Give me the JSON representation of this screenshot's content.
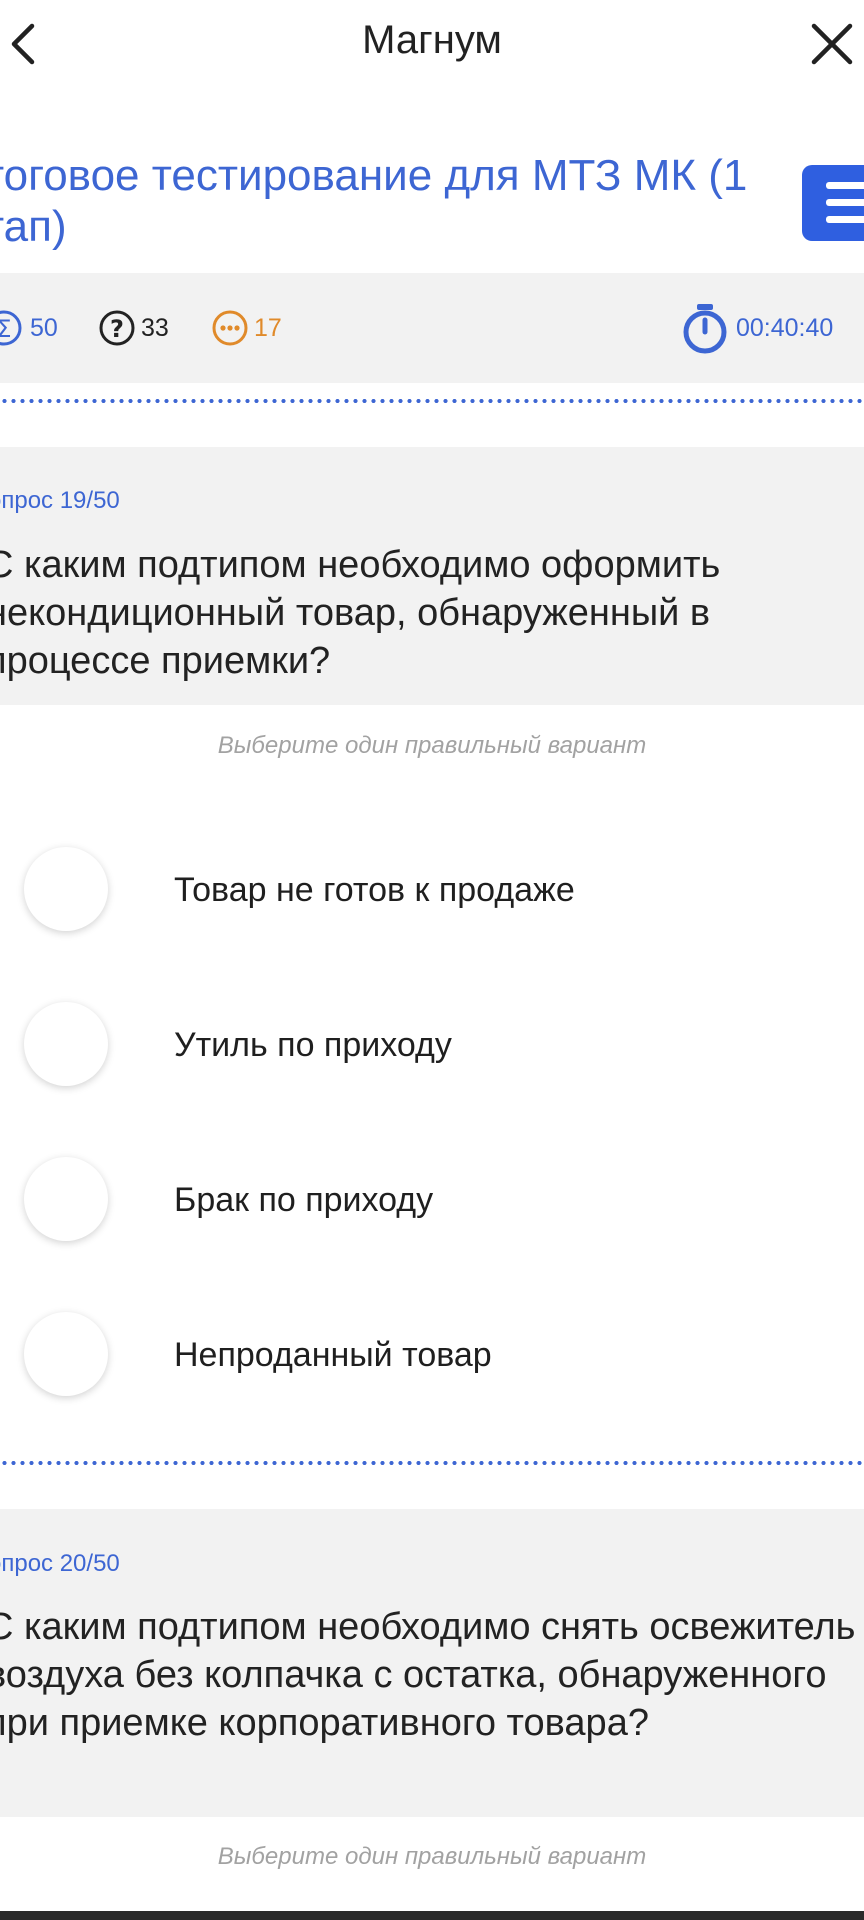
{
  "header": {
    "title": "Магнум",
    "back_icon": "chevron-left-icon",
    "close_icon": "close-icon"
  },
  "test": {
    "title": "тоговое тестирование для МТЗ МК (1 тап)",
    "menu_icon": "hamburger-menu-icon"
  },
  "stats": {
    "total": "50",
    "unanswered": "33",
    "remaining": "17",
    "timer": "00:40:40"
  },
  "colors": {
    "accent": "#3d66d3",
    "menu_button": "#2f5fe0",
    "orange": "#e08a2a",
    "panel": "#f2f2f2"
  },
  "questions": [
    {
      "number_label": "опрос 19/50",
      "text": "С каким подтипом необходимо оформить некондиционный товар, обнаруженный в процессе приемки?",
      "hint": "Выберите один правильный вариант",
      "options": [
        "Товар не готов к продаже",
        "Утиль по приходу",
        "Брак по приходу",
        "Непроданный товар"
      ]
    },
    {
      "number_label": "опрос 20/50",
      "text": "С каким подтипом необходимо снять освежитель воздуха без колпачка с остатка, обнаруженного при приемке корпоративного товара?",
      "hint": "Выберите один правильный вариант"
    }
  ]
}
